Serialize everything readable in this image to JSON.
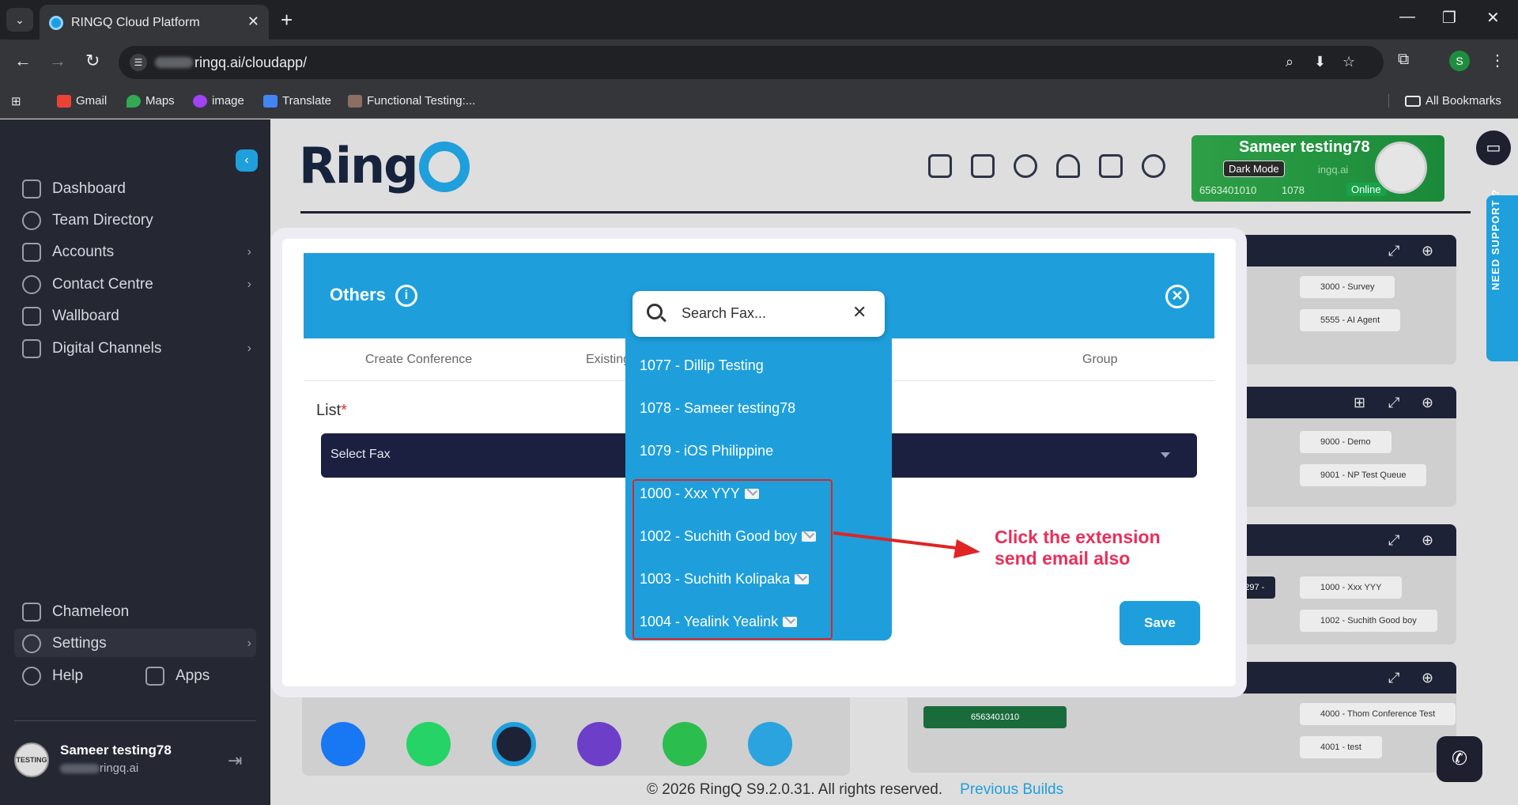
{
  "browser": {
    "tab_title": "RINGQ Cloud Platform",
    "url": "ringq.ai/cloudapp/",
    "bookmarks": [
      {
        "label": "Gmail",
        "icon": "gmail-icon",
        "color": "#ea4335"
      },
      {
        "label": "Maps",
        "icon": "maps-icon",
        "color": "#34a853"
      },
      {
        "label": "image",
        "icon": "image-icon",
        "color": "#a142f4"
      },
      {
        "label": "Translate",
        "icon": "translate-icon",
        "color": "#4285f4"
      },
      {
        "label": "Functional Testing:...",
        "icon": "testing-icon",
        "color": "#8d6e63"
      }
    ],
    "all_bookmarks": "All Bookmarks",
    "profile_initial": "S"
  },
  "sidebar": {
    "items": [
      {
        "label": "Dashboard",
        "icon": "home-icon"
      },
      {
        "label": "Team Directory",
        "icon": "person-icon"
      },
      {
        "label": "Accounts",
        "icon": "account-icon"
      },
      {
        "label": "Contact Centre",
        "icon": "phone-icon"
      },
      {
        "label": "Wallboard",
        "icon": "wallboard-icon"
      },
      {
        "label": "Digital Channels",
        "icon": "chat-icon"
      }
    ],
    "bottom_items": [
      {
        "label": "Chameleon",
        "icon": "clipboard-icon"
      },
      {
        "label": "Settings",
        "icon": "gear-icon"
      },
      {
        "label": "Help",
        "icon": "help-icon"
      },
      {
        "label": "Apps",
        "icon": "apps-icon"
      }
    ],
    "user": {
      "name": "Sameer testing78",
      "email": "ringq.ai",
      "avatar_text": "TESTING"
    }
  },
  "header": {
    "logo": "Ring",
    "user_card": {
      "name": "Sameer testing78",
      "mode": "Dark Mode",
      "number": "6563401010",
      "ext": "1078",
      "status": "Online",
      "domain": "ingq.ai"
    },
    "support": "NEED SUPPORT ?"
  },
  "panels": {
    "queue_pills": [
      "3000 - Survey",
      "5555 - AI Agent",
      "9000 - Demo",
      "9001 - NP Test Queue"
    ],
    "ext_pills": [
      "1000 - Xxx YYY",
      "1002 - Suchith Good boy",
      "4000 - Thom Conference Test",
      "4001 - test"
    ],
    "number_pill": "6563401010",
    "partial_pill": "23297 -"
  },
  "modal": {
    "title": "Others",
    "tabs": [
      "Create Conference",
      "Existing",
      "Group"
    ],
    "list_label": "List",
    "required_mark": "*",
    "select_placeholder": "Select Fax",
    "save_label": "Save"
  },
  "dropdown": {
    "search_placeholder": "Search Fax...",
    "items": [
      {
        "label": "1077 - Dillip Testing",
        "email": false
      },
      {
        "label": "1078 - Sameer testing78",
        "email": false
      },
      {
        "label": "1079 - iOS Philippine",
        "email": false
      },
      {
        "label": "1000 - Xxx YYY",
        "email": true
      },
      {
        "label": "1002 - Suchith Good boy",
        "email": true
      },
      {
        "label": "1003 - Suchith Kolipaka",
        "email": true
      },
      {
        "label": "1004 - Yealink Yealink",
        "email": true
      }
    ]
  },
  "annotation": {
    "line1": "Click the extension",
    "line2": "send email also"
  },
  "footer": {
    "copyright": "© 2026 RingQ S9.2.0.31. All rights reserved.",
    "link": "Previous Builds"
  },
  "colors": {
    "accent": "#1e9fdc",
    "sidebar": "#252833",
    "annotation": "#e8305a"
  }
}
